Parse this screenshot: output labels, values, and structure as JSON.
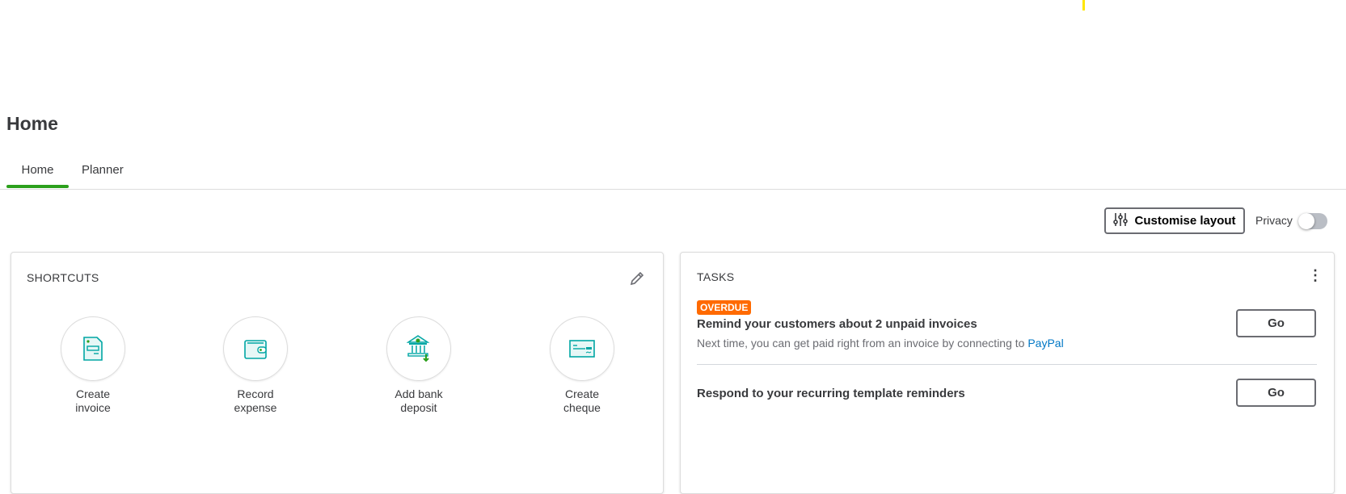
{
  "page": {
    "title": "Home"
  },
  "tabs": [
    {
      "label": "Home",
      "active": true
    },
    {
      "label": "Planner",
      "active": false
    }
  ],
  "toolbar": {
    "customise_label": "Customise layout",
    "privacy_label": "Privacy",
    "privacy_on": false
  },
  "shortcuts": {
    "title": "SHORTCUTS",
    "items": [
      {
        "line1": "Create",
        "line2": "invoice",
        "icon": "invoice-icon"
      },
      {
        "line1": "Record",
        "line2": "expense",
        "icon": "wallet-icon"
      },
      {
        "line1": "Add bank",
        "line2": "deposit",
        "icon": "bank-deposit-icon"
      },
      {
        "line1": "Create",
        "line2": "cheque",
        "icon": "cheque-icon"
      }
    ]
  },
  "tasks": {
    "title": "TASKS",
    "items": [
      {
        "badge": "OVERDUE",
        "title": "Remind your customers about 2 unpaid invoices",
        "subtitle": "Next time, you can get paid right from an invoice by connecting to ",
        "link": "PayPal",
        "button": "Go"
      },
      {
        "title": "Respond to your recurring template reminders",
        "button": "Go"
      }
    ]
  },
  "colors": {
    "accent": "#2ca01c",
    "badge": "#ff6a00",
    "link": "#0077c5",
    "icon": "#00a6a4"
  }
}
